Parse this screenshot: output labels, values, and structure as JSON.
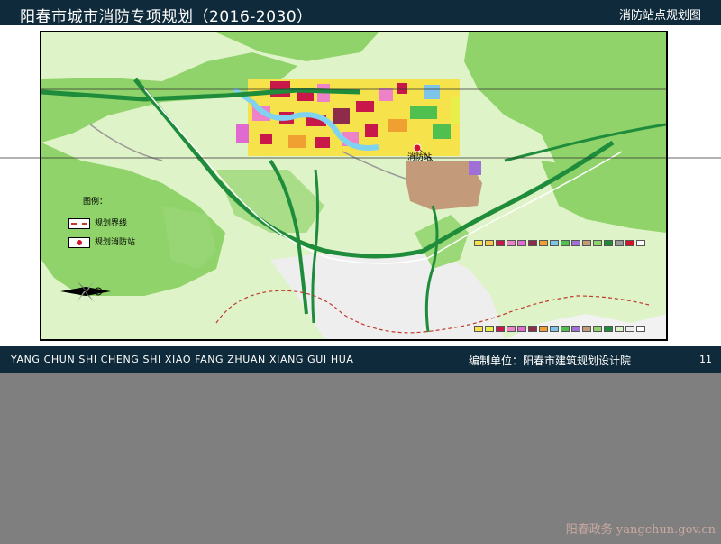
{
  "header": {
    "title": "阳春市城市消防专项规划（2016-2030）",
    "subtitle": "消防站点规划图"
  },
  "legend": {
    "title": "图例：",
    "items": [
      {
        "label": "规划界线",
        "kind": "boundary"
      },
      {
        "label": "规划消防站",
        "kind": "station"
      }
    ]
  },
  "map": {
    "station_label": "消防站"
  },
  "footer": {
    "pinyin": "YANG CHUN SHI CHENG SHI XIAO FANG ZHUAN XIANG GUI HUA",
    "org": "编制单位：阳春市建筑规划设计院",
    "page": "11"
  },
  "watermark": "阳春政务 yangchun.gov.cn",
  "colors": {
    "header_bg": "#0f2a3a",
    "station": "#d4122a",
    "boundary": "#c0392b",
    "mountain_green": "#8fd36a",
    "road_green": "#1e8c3a"
  }
}
